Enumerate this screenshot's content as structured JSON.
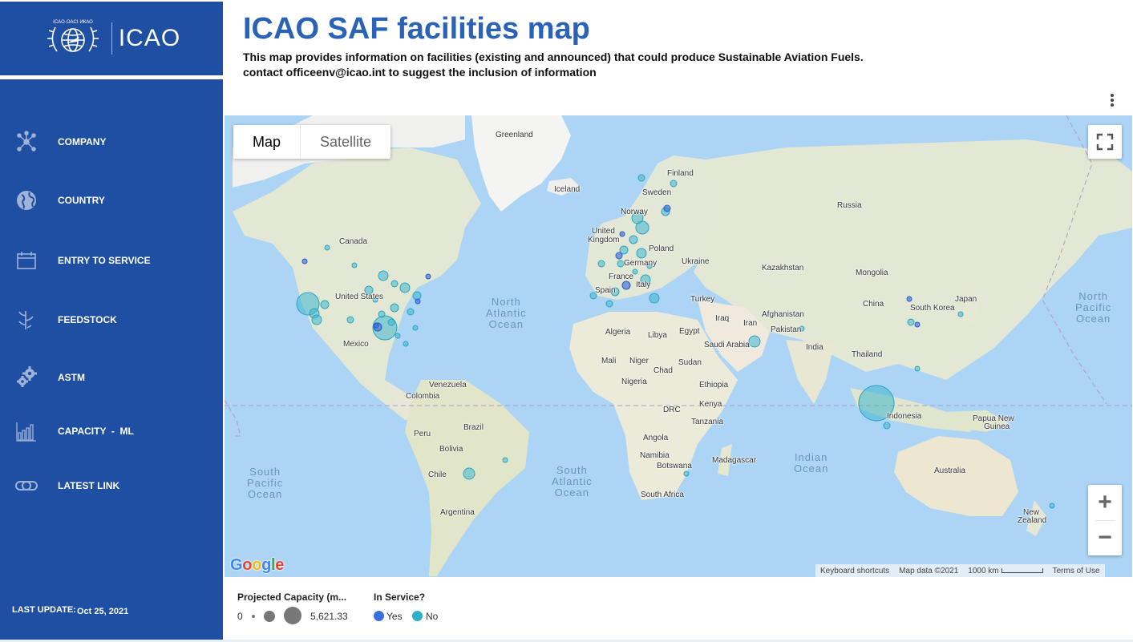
{
  "brand": {
    "logo_text": "ICAO",
    "primary_color": "#1f4fa3",
    "title_color": "#2a62b8"
  },
  "header": {
    "title": "ICAO SAF facilities map",
    "subtitle_line1": "This map provides information on facilities (existing and announced) that could produce Sustainable Aviation Fuels.",
    "subtitle_line2": "contact officeenv@icao.int to suggest the inclusion of information",
    "menu_icon": "more-vert-icon"
  },
  "sidebar": {
    "items": [
      {
        "label": "COMPANY",
        "icon": "network-icon"
      },
      {
        "label": "COUNTRY",
        "icon": "globe-icon"
      },
      {
        "label": "ENTRY TO SERVICE",
        "icon": "calendar-icon"
      },
      {
        "label": "FEEDSTOCK",
        "icon": "plant-icon"
      },
      {
        "label": "ASTM",
        "icon": "gears-icon"
      },
      {
        "label": "CAPACITY  -  ML",
        "icon": "bar-chart-icon"
      },
      {
        "label": "LATEST LINK",
        "icon": "link-icon"
      }
    ],
    "last_update_label": "LAST UPDATE:",
    "last_update_value": "Oct 25, 2021"
  },
  "map": {
    "type_buttons": {
      "map": "Map",
      "satellite": "Satellite",
      "selected": "Map"
    },
    "zoom_in": "+",
    "zoom_out": "−",
    "google_logo": "Google",
    "attribution": {
      "shortcuts": "Keyboard shortcuts",
      "data": "Map data ©2021",
      "scale": "1000 km",
      "terms": "Terms of Use"
    },
    "labels": {
      "greenland": "Greenland",
      "iceland": "Iceland",
      "finland": "Finland",
      "sweden": "Sweden",
      "norway": "Norway",
      "russia": "Russia",
      "canada": "Canada",
      "united_kingdom_1": "United",
      "united_kingdom_2": "Kingdom",
      "poland": "Poland",
      "germany": "Germany",
      "ukraine": "Ukraine",
      "france": "France",
      "kazakhstan": "Kazakhstan",
      "mongolia": "Mongolia",
      "spain": "Spain",
      "italy": "Italy",
      "united_states": "United States",
      "turkey": "Turkey",
      "china": "China",
      "south_korea": "South Korea",
      "japan": "Japan",
      "afghanistan": "Afghanistan",
      "iraq": "Iraq",
      "iran": "Iran",
      "pakistan": "Pakistan",
      "algeria": "Algeria",
      "libya": "Libya",
      "egypt": "Egypt",
      "saudi_arabia": "Saudi Arabia",
      "mexico": "Mexico",
      "india": "India",
      "thailand": "Thailand",
      "mali": "Mali",
      "niger": "Niger",
      "chad": "Chad",
      "sudan": "Sudan",
      "ethiopia": "Ethiopia",
      "nigeria": "Nigeria",
      "venezuela": "Venezuela",
      "colombia": "Colombia",
      "kenya": "Kenya",
      "drc": "DRC",
      "indonesia": "Indonesia",
      "papua_1": "Papua New",
      "papua_2": "Guinea",
      "tanzania": "Tanzania",
      "peru": "Peru",
      "brazil": "Brazil",
      "angola": "Angola",
      "bolivia": "Bolivia",
      "namibia": "Namibia",
      "botswana": "Botswana",
      "madagascar": "Madagascar",
      "australia": "Australia",
      "chile": "Chile",
      "south_africa": "South Africa",
      "argentina": "Argentina",
      "new_zealand_1": "New",
      "new_zealand_2": "Zealand"
    },
    "oceans": {
      "north_atlantic": "North\nAtlantic\nOcean",
      "north_pacific": "North\nPacific\nOcean",
      "south_pacific": "South\nPacific\nOcean",
      "south_atlantic": "South\nAtlantic\nOcean",
      "indian": "Indian\nOcean"
    }
  },
  "legend": {
    "capacity_title": "Projected Capacity (m...",
    "capacity_min": "0",
    "capacity_max": "5,621.33",
    "service_title": "In Service?",
    "yes_label": "Yes",
    "no_label": "No",
    "yes_color": "#3b6fdb",
    "no_color": "#2fb0c8"
  }
}
